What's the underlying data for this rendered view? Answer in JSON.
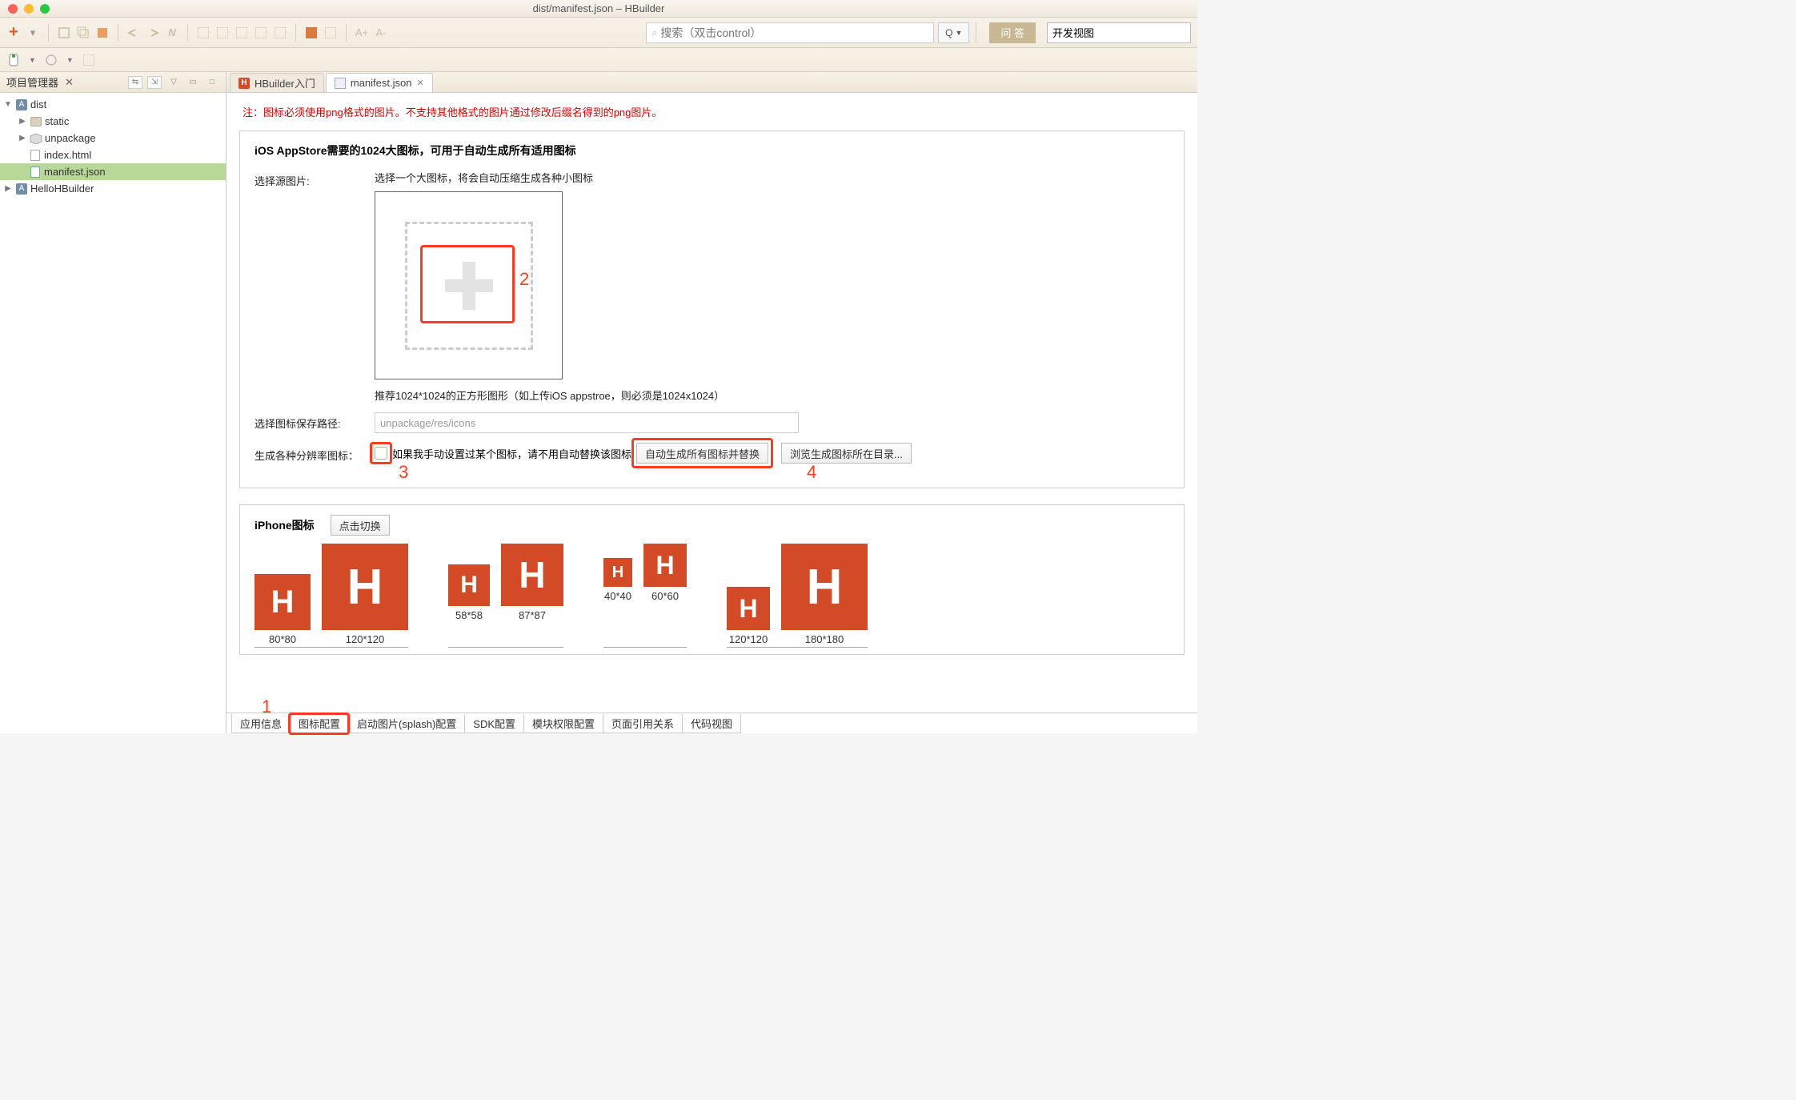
{
  "window": {
    "title": "dist/manifest.json – HBuilder"
  },
  "toolbar": {
    "search_placeholder": "搜索（双击control）",
    "qa_label": "问 答",
    "view_label": "开发视图"
  },
  "sidebar": {
    "title": "项目管理器",
    "tree": {
      "root1": "dist",
      "static": "static",
      "unpackage": "unpackage",
      "index": "index.html",
      "manifest": "manifest.json",
      "root2": "HelloHBuilder"
    }
  },
  "tabs": {
    "t1": "HBuilder入门",
    "t2": "manifest.json"
  },
  "editor": {
    "warning": "注：图标必须使用png格式的图片。不支持其他格式的图片通过修改后缀名得到的png图片。",
    "section1_title": "iOS AppStore需要的1024大图标，可用于自动生成所有适用图标",
    "src_label": "选择源图片:",
    "src_hint": "选择一个大图标，将会自动压缩生成各种小图标",
    "size_hint": "推荐1024*1024的正方形图形（如上传iOS appstroe，则必须是1024x1024）",
    "path_label": "选择图标保存路径:",
    "path_value": "unpackage/res/icons",
    "gen_label": "生成各种分辨率图标：",
    "gen_chk_text": "如果我手动设置过某个图标，请不用自动替换该图标",
    "gen_btn": "自动生成所有图标并替换",
    "browse_btn": "浏览生成图标所在目录...",
    "iphone_title": "iPhone图标",
    "switch_btn": "点击切换",
    "annot": {
      "n1": "1",
      "n2": "2",
      "n3": "3",
      "n4": "4"
    },
    "icons": {
      "g1a": "80*80",
      "g1b": "120*120",
      "g2a": "58*58",
      "g2b": "87*87",
      "g3a": "40*40",
      "g3b": "60*60",
      "g4a": "120*120",
      "g4b": "180*180"
    }
  },
  "bottom_tabs": {
    "t1": "应用信息",
    "t2": "图标配置",
    "t3": "启动图片(splash)配置",
    "t4": "SDK配置",
    "t5": "模块权限配置",
    "t6": "页面引用关系",
    "t7": "代码视图"
  }
}
